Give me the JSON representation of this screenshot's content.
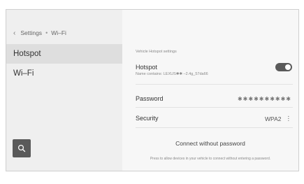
{
  "breadcrumb": {
    "back_icon": "‹",
    "root": "Settings",
    "separator": "•",
    "current": "Wi–Fi"
  },
  "sidebar": {
    "items": [
      {
        "label": "Hotspot",
        "active": true
      },
      {
        "label": "Wi–Fi",
        "active": false
      }
    ],
    "search_icon": "search-icon"
  },
  "main": {
    "section_label": "Vehicle Hotspot settings",
    "hotspot": {
      "title": "Hotspot",
      "subtitle": "Name contains: LEXUS✱✱ –2.4g_57da66",
      "toggle_on": true
    },
    "password": {
      "label": "Password",
      "value": "✱✱✱✱✱✱✱✱✱✱"
    },
    "security": {
      "label": "Security",
      "value": "WPA2",
      "more_icon": "⋮"
    },
    "connect": {
      "label": "Connect without password",
      "description": "Press to allow devices in your vehicle to connect without entering a password."
    }
  },
  "colors": {
    "toggle": "#5a5a5a",
    "search_button": "#5a5a5a",
    "active_item": "#dedede"
  }
}
